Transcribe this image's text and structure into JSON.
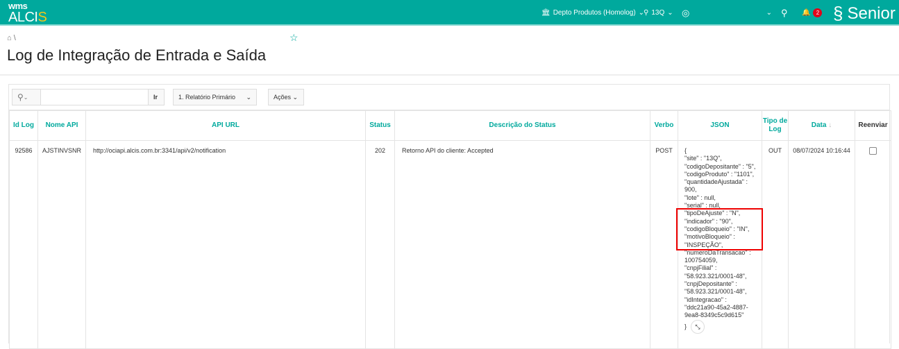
{
  "header": {
    "logo_top": "wms",
    "logo_main": "ALCI",
    "logo_accent": "S",
    "department": "Depto Produtos (Homolog)",
    "site": "13Q",
    "notifications": "2",
    "brand": "Senior"
  },
  "breadcrumb": {
    "separator": "\\"
  },
  "page": {
    "title": "Log de Integração de Entrada e Saída"
  },
  "toolbar": {
    "go_label": "Ir",
    "report": "1. Relatório Primário",
    "actions_label": "Ações",
    "search_value": ""
  },
  "table": {
    "headers": [
      "Id Log",
      "Nome API",
      "API URL",
      "Status",
      "Descrição do Status",
      "Verbo",
      "JSON",
      "Tipo de Log",
      "Data",
      "Reenviar"
    ],
    "rows": [
      {
        "id": "92586",
        "api": "AJSTINVSNR",
        "url": "http://ociapi.alcis.com.br:3341/api/v2/notification",
        "status": "202",
        "desc": "Retorno API do cliente: Accepted",
        "verb": "POST",
        "json_before": [
          "{",
          "\"site\" : \"13Q\",",
          "\"codigoDepositante\" : \"5\",",
          "\"codigoProduto\" : \"1101\",",
          "\"quantidadeAjustada\" :",
          "900,",
          "\"lote\" : null,",
          "\"serial\" : null,"
        ],
        "json_highlight": [
          "\"tipoDeAjuste\" : \"N\",",
          "\"indicador\" : \"90\",",
          "\"codigoBloqueio\" : \"IN\",",
          "\"motivoBloqueio\" :",
          "\"INSPEÇÃO\","
        ],
        "json_after": [
          "\"numeroDaTransacao\" :",
          "100754059,",
          "\"cnpjFilial\" :",
          "\"58.923.321/0001-48\",",
          "\"cnpjDepositante\" :",
          "\"58.923.321/0001-48\",",
          "\"idIntegracao\" :",
          "\"ddc21a90-45a2-4887-",
          "9ea8-8349c5c9d615\""
        ],
        "json_end": "}",
        "type": "OUT",
        "date": "08/07/2024 10:16:44"
      }
    ]
  }
}
